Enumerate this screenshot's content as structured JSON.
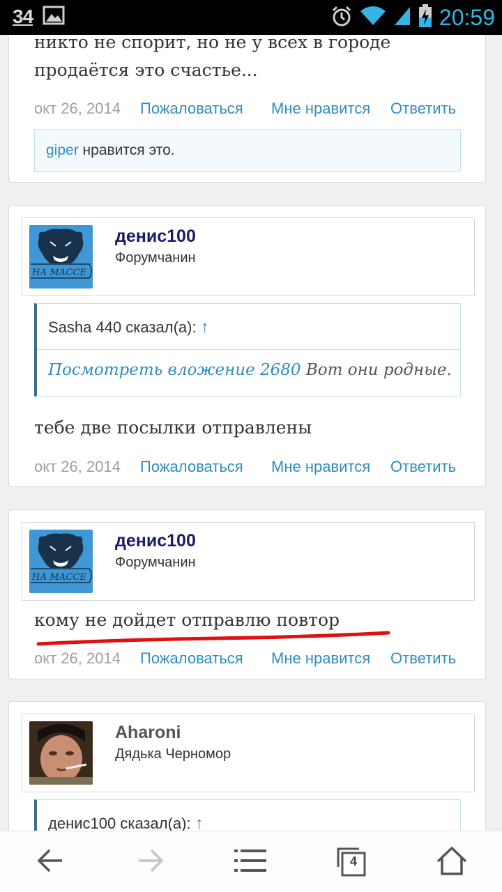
{
  "status_bar": {
    "notification_count": "34",
    "time": "20:59",
    "icons": [
      "image-icon",
      "alarm-icon",
      "wifi-icon",
      "signal-icon",
      "battery-charging-icon"
    ]
  },
  "posts": [
    {
      "message_lines": [
        "никто не спорит, но не у всех в городе",
        "продаётся это счастье..."
      ],
      "date": "окт 26, 2014",
      "report": "Пожаловаться",
      "like": "Мне нравится",
      "reply": "Ответить",
      "likes": {
        "user": "giper",
        "text": " нравится это."
      }
    },
    {
      "author": {
        "name": "денис100",
        "title": "Форумчанин",
        "avatar_text": "НА МАССЕ"
      },
      "quote": {
        "author_said": "Sasha 440 сказал(а): ",
        "arrow": "↑",
        "attachment": "Посмотреть вложение 2680",
        "text": " Вот они родные."
      },
      "message": "тебе две посылки отправлены",
      "date": "окт 26, 2014",
      "report": "Пожаловаться",
      "like": "Мне нравится",
      "reply": "Ответить"
    },
    {
      "author": {
        "name": "денис100",
        "title": "Форумчанин",
        "avatar_text": "НА МАССЕ"
      },
      "message": "кому не дойдет отправлю повтор",
      "date": "окт 26, 2014",
      "report": "Пожаловаться",
      "like": "Мне нравится",
      "reply": "Ответить"
    },
    {
      "author": {
        "name": "Aharoni",
        "title": "Дядька Черномор"
      },
      "quote": {
        "author_said": "денис100 сказал(а): ",
        "arrow": "↑"
      }
    }
  ],
  "navbar": {
    "tab_count": "4",
    "icons": [
      "back-arrow-icon",
      "forward-arrow-icon",
      "menu-icon",
      "tabs-icon",
      "home-icon"
    ]
  },
  "colors": {
    "link": "#2e8dc0",
    "author_name": "#1a1a6e",
    "status_time": "#33b5e5",
    "annotation_underline": "#e01010"
  }
}
